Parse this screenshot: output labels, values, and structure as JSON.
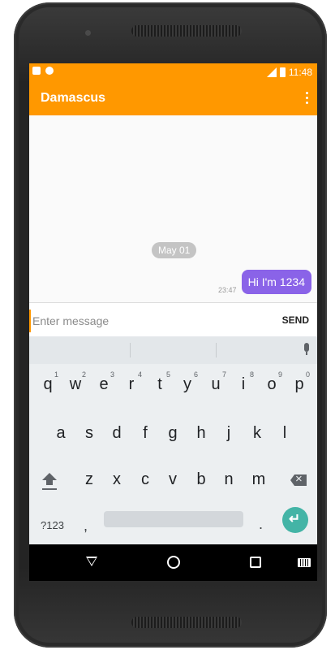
{
  "status_bar": {
    "time": "11:48",
    "signal_icon": "signal-icon",
    "battery_icon": "battery-icon"
  },
  "app_bar": {
    "title": "Damascus",
    "menu_icon": "overflow-menu-icon"
  },
  "chat": {
    "date_divider": "May 01",
    "messages": [
      {
        "text": "Hi I'm 1234",
        "time": "23:47",
        "outgoing": true
      }
    ]
  },
  "composer": {
    "placeholder": "Enter message",
    "send_label": "SEND"
  },
  "keyboard": {
    "row1": [
      {
        "key": "q",
        "hint": "1"
      },
      {
        "key": "w",
        "hint": "2"
      },
      {
        "key": "e",
        "hint": "3"
      },
      {
        "key": "r",
        "hint": "4"
      },
      {
        "key": "t",
        "hint": "5"
      },
      {
        "key": "y",
        "hint": "6"
      },
      {
        "key": "u",
        "hint": "7"
      },
      {
        "key": "i",
        "hint": "8"
      },
      {
        "key": "o",
        "hint": "9"
      },
      {
        "key": "p",
        "hint": "0"
      }
    ],
    "row2": [
      "a",
      "s",
      "d",
      "f",
      "g",
      "h",
      "j",
      "k",
      "l"
    ],
    "row3": [
      "z",
      "x",
      "c",
      "v",
      "b",
      "n",
      "m"
    ],
    "symbols_label": "?123",
    "comma": ",",
    "period": "."
  },
  "colors": {
    "accent": "#ff9800",
    "bubble": "#8a63e8",
    "enter_key": "#43b4a6"
  }
}
